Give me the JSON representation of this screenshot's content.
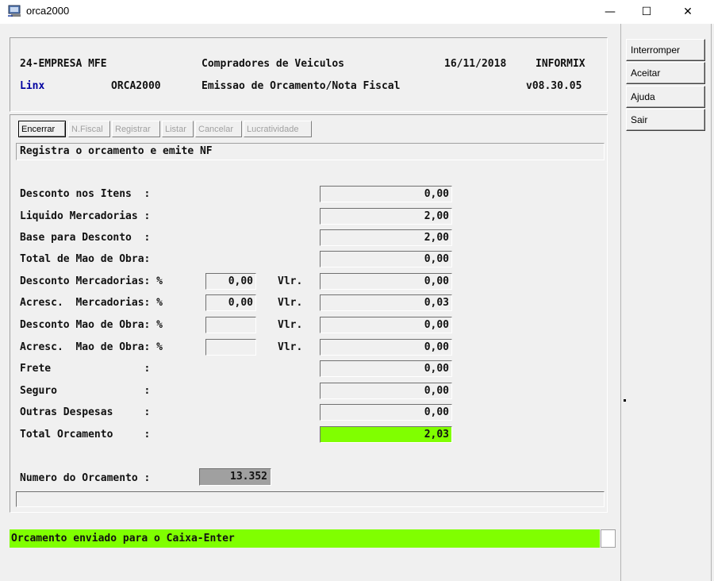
{
  "window": {
    "title": "orca2000",
    "minimize": "—",
    "maximize": "☐",
    "close": "✕"
  },
  "header": {
    "company": "24-EMPRESA MFE",
    "module_title": "Compradores de Veiculos",
    "date": "16/11/2018",
    "db": "INFORMIX",
    "brand": "Linx",
    "program": "ORCA2000",
    "subtitle": "Emissao de Orcamento/Nota Fiscal",
    "version": "v08.30.05"
  },
  "toolbar": {
    "encerrar": "Encerrar",
    "nfiscal": "N.Fiscal",
    "registrar": "Registrar",
    "listar": "Listar",
    "cancelar": "Cancelar",
    "lucratividade": "Lucratividade"
  },
  "message": "Registra o orcamento e emite NF",
  "fields": {
    "desconto_itens": {
      "label": "Desconto nos Itens  :",
      "value": "0,00"
    },
    "liquido_mercadorias": {
      "label": "Liquido Mercadorias :",
      "value": "2,00"
    },
    "base_desconto": {
      "label": "Base para Desconto  :",
      "value": "2,00"
    },
    "total_mao_obra": {
      "label": "Total de Mao de Obra:",
      "value": "0,00"
    },
    "desconto_mercadorias": {
      "label": "Desconto Mercadorias: %",
      "pct": "0,00",
      "vlr_label": "Vlr.",
      "value": "0,00"
    },
    "acresc_mercadorias": {
      "label": "Acresc.  Mercadorias: %",
      "pct": "0,00",
      "vlr_label": "Vlr.",
      "value": "0,03"
    },
    "desconto_mao_obra": {
      "label": "Desconto Mao de Obra: %",
      "pct": "",
      "vlr_label": "Vlr.",
      "value": "0,00"
    },
    "acresc_mao_obra": {
      "label": "Acresc.  Mao de Obra: %",
      "pct": "",
      "vlr_label": "Vlr.",
      "value": "0,00"
    },
    "frete": {
      "label": "Frete               :",
      "value": "0,00"
    },
    "seguro": {
      "label": "Seguro              :",
      "value": "0,00"
    },
    "outras_despesas": {
      "label": "Outras Despesas     :",
      "value": "0,00"
    },
    "total_orcamento": {
      "label": "Total Orcamento     :",
      "value": "2,03"
    }
  },
  "numero": {
    "label": "Numero do Orcamento :",
    "value": "13.352"
  },
  "status": "Orcamento enviado para o Caixa-Enter",
  "side_buttons": {
    "interromper": "Interromper",
    "aceitar": "Aceitar",
    "ajuda": "Ajuda",
    "sair": "Sair"
  },
  "colors": {
    "highlight_green": "#80ff00",
    "brand_blue": "#0000a0"
  }
}
